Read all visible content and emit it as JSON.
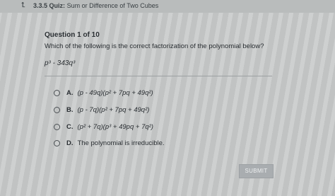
{
  "header": {
    "back_icon": "back-arrow-icon",
    "lesson_number": "3.3.5",
    "quiz_label": "Quiz:",
    "lesson_title": "Sum or Difference of Two Cubes"
  },
  "question": {
    "number_label": "Question 1 of 10",
    "text": "Which of the following is the correct factorization of the polynomial below?",
    "polynomial": "p³ - 343q³"
  },
  "options": [
    {
      "letter": "A.",
      "text": "(p - 49q)(p² + 7pq + 49q²)"
    },
    {
      "letter": "B.",
      "text": "(p - 7q)(p² + 7pq + 49q²)"
    },
    {
      "letter": "C.",
      "text": "(p² + 7q)(p³ + 49pq + 7q²)"
    },
    {
      "letter": "D.",
      "text": "The polynomial is irreducible."
    }
  ],
  "submit_label": "SUBMIT"
}
